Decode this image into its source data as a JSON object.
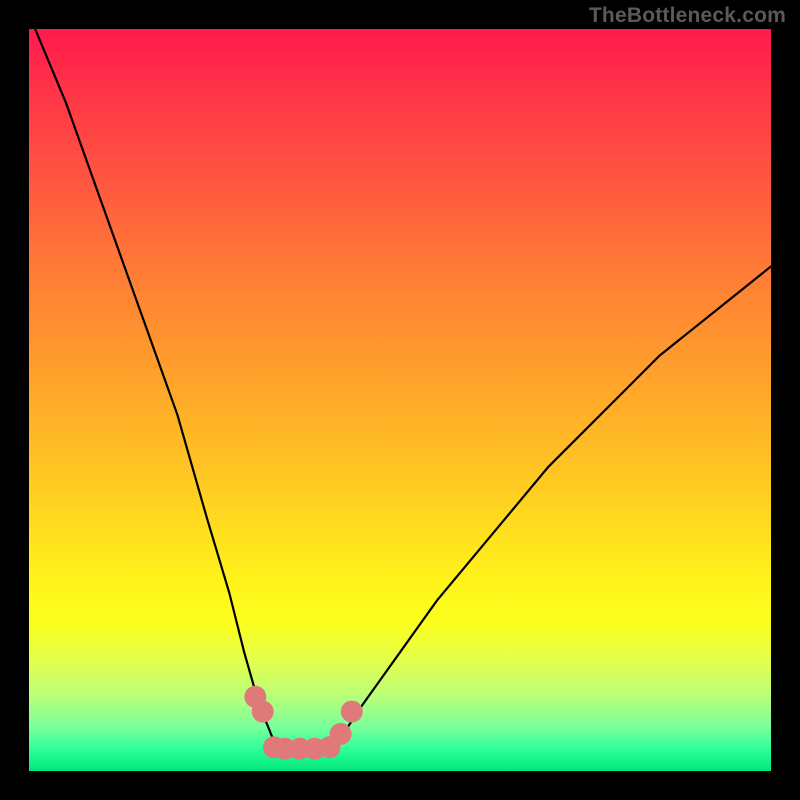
{
  "watermark": "TheBottleneck.com",
  "chart_data": {
    "type": "line",
    "title": "",
    "xlabel": "",
    "ylabel": "",
    "xlim": [
      0,
      100
    ],
    "ylim": [
      0,
      100
    ],
    "series": [
      {
        "name": "bottleneck-curve",
        "x": [
          0,
          5,
          10,
          15,
          20,
          24,
          27,
          29,
          31,
          33,
          34,
          35,
          37,
          40,
          43,
          45,
          50,
          55,
          60,
          65,
          70,
          75,
          80,
          85,
          90,
          95,
          100
        ],
        "y": [
          102,
          90,
          76,
          62,
          48,
          34,
          24,
          16,
          9,
          4,
          3,
          3,
          3,
          3,
          6,
          9,
          16,
          23,
          29,
          35,
          41,
          46,
          51,
          56,
          60,
          64,
          68
        ]
      }
    ],
    "markers": {
      "name": "highlighted-points",
      "color": "#e07a7a",
      "x": [
        30.5,
        31.5,
        33.0,
        34.5,
        36.5,
        38.5,
        40.5,
        42.0,
        43.5
      ],
      "y": [
        10.0,
        8.0,
        3.2,
        3.0,
        3.0,
        3.0,
        3.2,
        5.0,
        8.0
      ]
    },
    "background_gradient": {
      "top": "#ff1a4d",
      "mid": "#ffd91f",
      "bottom": "#00e87a"
    }
  }
}
